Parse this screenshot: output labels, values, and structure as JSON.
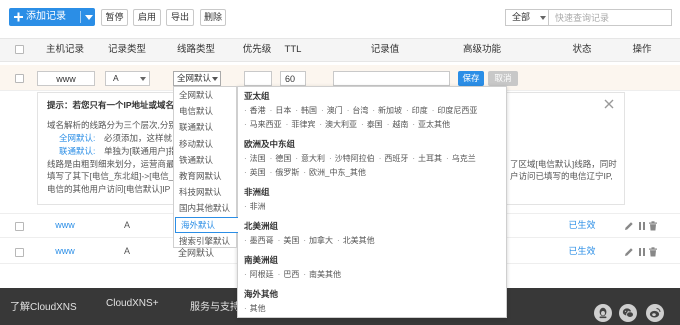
{
  "theme": {
    "accent": "#2b8ee6",
    "status_color": "#2b8ee6",
    "footer_bg": "#383838"
  },
  "toolbar": {
    "add_label": "添加记录",
    "pause_label": "暂停",
    "enable_label": "启用",
    "export_label": "导出",
    "delete_label": "删除",
    "filter_value": "全部",
    "search_placeholder": "快速查询记录"
  },
  "table": {
    "headers": [
      "主机记录",
      "记录类型",
      "线路类型",
      "优先级",
      "TTL",
      "记录值",
      "高级功能",
      "状态",
      "操作"
    ]
  },
  "edit_row": {
    "host": "www",
    "type": "A",
    "line": "全网默认",
    "priority": "",
    "ttl": "60",
    "value": "",
    "save_label": "保存",
    "cancel_label": "取消"
  },
  "tip": {
    "title": "提示：若您只有一个IP地址或域名，",
    "lines": [
      {
        "left": "域名解析的线路分为三个层次,分别为",
        "right": ""
      },
      {
        "key": "全网默认:",
        "left": "必须添加，这样就",
        "right": ""
      },
      {
        "key": "联通默认:",
        "left": "单独为[联通用户]指",
        "right": ""
      },
      {
        "left": "线路是由粗到细来划分，运营商最粗",
        "right": "了区域[电信默认]线路，同时"
      },
      {
        "left": "填写了其下[电信_东北组]->[电信_辽",
        "right": "户访问已填写的电信辽宁IP,"
      },
      {
        "left": "电信的其他用户访问[电信默认]IP",
        "right": ""
      }
    ]
  },
  "line_dropdown": {
    "selected_index": 8,
    "items": [
      "全网默认",
      "电信默认",
      "联通默认",
      "移动默认",
      "铁通默认",
      "教育网默认",
      "科技网默认",
      "国内其他默认",
      "海外默认",
      "搜索引擎默认"
    ]
  },
  "region_panel": {
    "groups": [
      {
        "name": "亚太组",
        "rows": [
          [
            "香港",
            "日本",
            "韩国",
            "澳门",
            "台湾",
            "新加坡",
            "印度",
            "印度尼西亚"
          ],
          [
            "马来西亚",
            "菲律宾",
            "澳大利亚",
            "泰国",
            "越南",
            "亚太其他"
          ]
        ]
      },
      {
        "name": "欧洲及中东组",
        "rows": [
          [
            "法国",
            "德国",
            "意大利",
            "沙特阿拉伯",
            "西班牙",
            "土耳其",
            "乌克兰"
          ],
          [
            "英国",
            "俄罗斯",
            "欧洲_中东_其他"
          ]
        ]
      },
      {
        "name": "非洲组",
        "rows": [
          [
            "非洲"
          ]
        ]
      },
      {
        "name": "北美洲组",
        "rows": [
          [
            "墨西哥",
            "美国",
            "加拿大",
            "北美其他"
          ]
        ]
      },
      {
        "name": "南美洲组",
        "rows": [
          [
            "阿根廷",
            "巴西",
            "南美其他"
          ]
        ]
      },
      {
        "name": "海外其他",
        "rows": [
          [
            "其他"
          ]
        ]
      }
    ]
  },
  "records": [
    {
      "host": "www",
      "type": "A",
      "status": "已生效"
    },
    {
      "host": "www",
      "type": "A",
      "line": "全网默认",
      "status": "已生效"
    }
  ],
  "footer": {
    "links": [
      "了解CloudXNS",
      "CloudXNS+",
      "服务与支持"
    ],
    "social_icons": [
      "qq-icon",
      "wechat-icon",
      "weibo-icon"
    ]
  }
}
